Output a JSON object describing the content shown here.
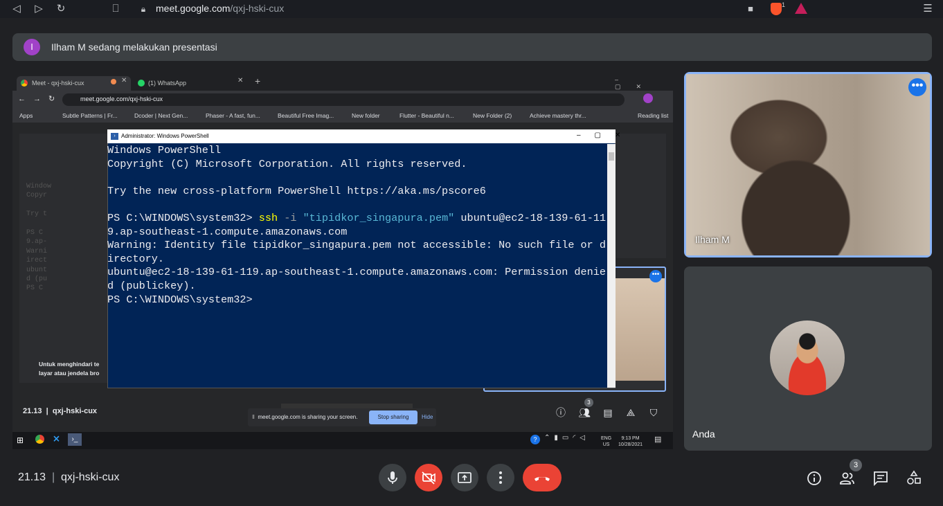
{
  "browser": {
    "url_domain": "meet.google.com",
    "url_path": "/qxj-hski-cux",
    "icons": [
      "back-icon",
      "forward-icon",
      "reload-icon",
      "bookmark-icon",
      "camera-icon",
      "brave-shield-icon",
      "menu-icon"
    ],
    "brave_badge": "1"
  },
  "banner": {
    "avatar_letter": "I",
    "text": "Ilham M sedang melakukan presentasi"
  },
  "shared_screen": {
    "tabs": [
      "Meet - qxj-hski-cux",
      "(1) WhatsApp"
    ],
    "url": "meet.google.com/qxj-hski-cux",
    "bookmarks": [
      "Apps",
      "Subtle Patterns | Fr...",
      "Dcoder | Next Gen...",
      "Phaser - A fast, fun...",
      "Beautiful Free Imag...",
      "New folder",
      "Flutter - Beautiful n...",
      "New Folder (2)",
      "Achieve mastery thr...",
      "Reading list"
    ],
    "powershell_title": "Administrator: Windows PowerShell",
    "powershell": {
      "l1": "Windows PowerShell",
      "l2": "Copyright (C) Microsoft Corporation. All rights reserved.",
      "l3": "Try the new cross-platform PowerShell https://aka.ms/pscore6",
      "prompt": "PS C:\\WINDOWS\\system32> ",
      "cmd": "ssh",
      "flag": " -i ",
      "arg": "\"tipidkor_singapura.pem\"",
      "cmd_rest": " ubuntu@ec2-18-139-61-11",
      "l5": "9.ap-southeast-1.compute.amazonaws.com",
      "l6": "Warning: Identity file tipidkor_singapura.pem not accessible: No such file or d",
      "l7": "irectory.",
      "l8": "ubuntu@ec2-18-139-61-119.ap-southeast-1.compute.amazonaws.com: Permission denie",
      "l9": "d (publickey).",
      "l10": "PS C:\\WINDOWS\\system32>"
    },
    "ghost_text": {
      "g1": "Window",
      "g2": "Copyr",
      "g3": "Try t",
      "g4": "PS C",
      "g5": "9.ap-",
      "g6": "Warni",
      "g7": "irect",
      "g8": "ubunt",
      "g9": "d (pu",
      "g10": "PS C",
      "hint1": "Untuk menghindari te",
      "hint2": "layar atau jendela bro"
    },
    "inner_time": "21.13",
    "inner_code": "qxj-hski-cux",
    "share_bar": {
      "text": "meet.google.com is sharing your screen.",
      "stop": "Stop sharing",
      "hide": "Hide"
    },
    "inner_people_badge": "3",
    "tray": {
      "lang1": "ENG",
      "lang2": "US",
      "time": "9:13 PM",
      "date": "10/28/2021"
    }
  },
  "participants": {
    "main": {
      "name": "Ilham M"
    },
    "self": {
      "name": "Anda"
    }
  },
  "bottom_bar": {
    "time": "21.13",
    "separator": "|",
    "meeting_code": "qxj-hski-cux",
    "people_count": "3"
  },
  "colors": {
    "accent": "#8ab4f8",
    "danger": "#ea4335",
    "surface": "#3c4043",
    "background": "#202124",
    "powershell_bg": "#012456"
  }
}
